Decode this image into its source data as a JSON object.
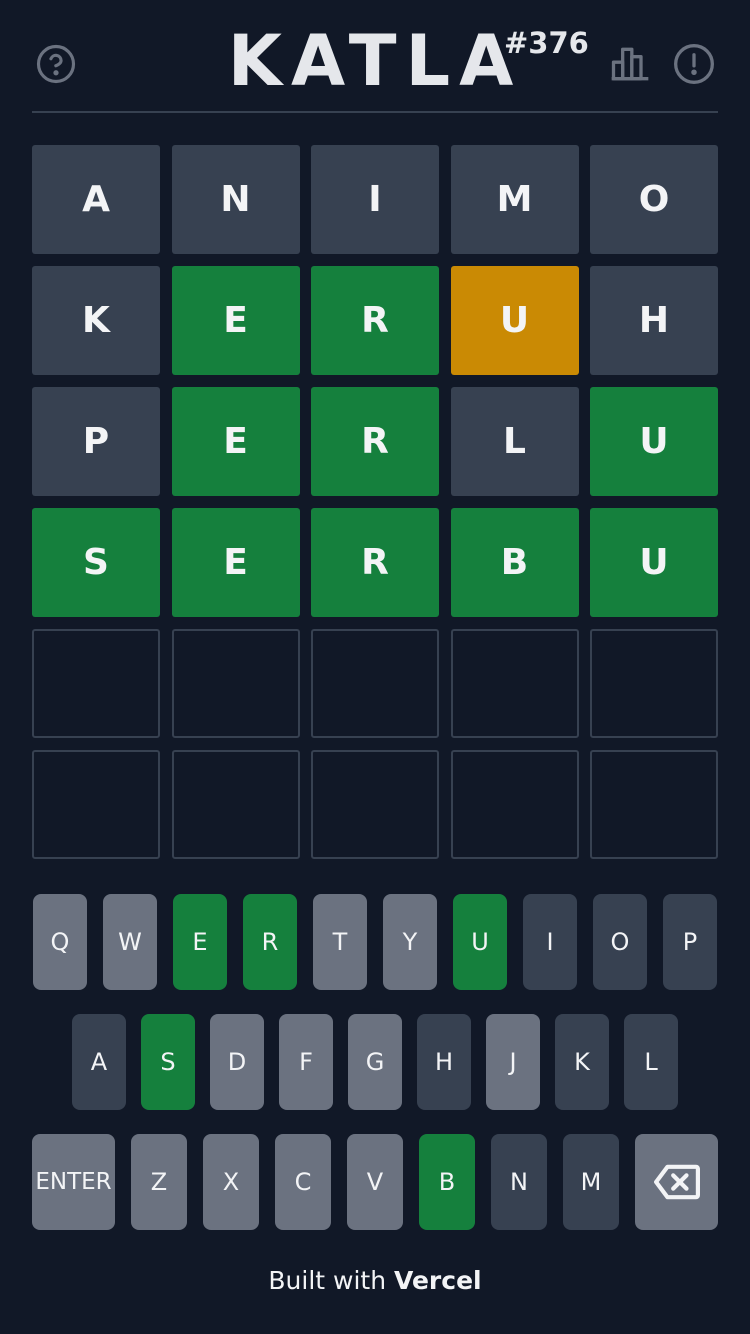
{
  "header": {
    "title": "KATLA",
    "game_number": "#376",
    "icons": [
      "help-icon",
      "stats-icon",
      "about-icon"
    ]
  },
  "board": {
    "rows": [
      [
        {
          "letter": "A",
          "state": "absent"
        },
        {
          "letter": "N",
          "state": "absent"
        },
        {
          "letter": "I",
          "state": "absent"
        },
        {
          "letter": "M",
          "state": "absent"
        },
        {
          "letter": "O",
          "state": "absent"
        }
      ],
      [
        {
          "letter": "K",
          "state": "absent"
        },
        {
          "letter": "E",
          "state": "correct"
        },
        {
          "letter": "R",
          "state": "correct"
        },
        {
          "letter": "U",
          "state": "present"
        },
        {
          "letter": "H",
          "state": "absent"
        }
      ],
      [
        {
          "letter": "P",
          "state": "absent"
        },
        {
          "letter": "E",
          "state": "correct"
        },
        {
          "letter": "R",
          "state": "correct"
        },
        {
          "letter": "L",
          "state": "absent"
        },
        {
          "letter": "U",
          "state": "correct"
        }
      ],
      [
        {
          "letter": "S",
          "state": "correct"
        },
        {
          "letter": "E",
          "state": "correct"
        },
        {
          "letter": "R",
          "state": "correct"
        },
        {
          "letter": "B",
          "state": "correct"
        },
        {
          "letter": "U",
          "state": "correct"
        }
      ],
      [
        {
          "letter": "",
          "state": "empty"
        },
        {
          "letter": "",
          "state": "empty"
        },
        {
          "letter": "",
          "state": "empty"
        },
        {
          "letter": "",
          "state": "empty"
        },
        {
          "letter": "",
          "state": "empty"
        }
      ],
      [
        {
          "letter": "",
          "state": "empty"
        },
        {
          "letter": "",
          "state": "empty"
        },
        {
          "letter": "",
          "state": "empty"
        },
        {
          "letter": "",
          "state": "empty"
        },
        {
          "letter": "",
          "state": "empty"
        }
      ]
    ]
  },
  "keyboard": {
    "rows": [
      [
        {
          "key": "Q",
          "state": "unused"
        },
        {
          "key": "W",
          "state": "unused"
        },
        {
          "key": "E",
          "state": "correct"
        },
        {
          "key": "R",
          "state": "correct"
        },
        {
          "key": "T",
          "state": "unused"
        },
        {
          "key": "Y",
          "state": "unused"
        },
        {
          "key": "U",
          "state": "correct"
        },
        {
          "key": "I",
          "state": "absent"
        },
        {
          "key": "O",
          "state": "absent"
        },
        {
          "key": "P",
          "state": "absent"
        }
      ],
      [
        {
          "key": "A",
          "state": "absent"
        },
        {
          "key": "S",
          "state": "correct"
        },
        {
          "key": "D",
          "state": "unused"
        },
        {
          "key": "F",
          "state": "unused"
        },
        {
          "key": "G",
          "state": "unused"
        },
        {
          "key": "H",
          "state": "absent"
        },
        {
          "key": "J",
          "state": "unused"
        },
        {
          "key": "K",
          "state": "absent"
        },
        {
          "key": "L",
          "state": "absent"
        }
      ],
      [
        {
          "key": "ENTER",
          "state": "unused"
        },
        {
          "key": "Z",
          "state": "unused"
        },
        {
          "key": "X",
          "state": "unused"
        },
        {
          "key": "C",
          "state": "unused"
        },
        {
          "key": "V",
          "state": "unused"
        },
        {
          "key": "B",
          "state": "correct"
        },
        {
          "key": "N",
          "state": "absent"
        },
        {
          "key": "M",
          "state": "absent"
        },
        {
          "key": "",
          "state": "unused",
          "icon": "backspace-icon"
        }
      ]
    ]
  },
  "footer": {
    "prefix": "Built with ",
    "brand": "Vercel"
  },
  "colors": {
    "background": "#111827",
    "correct": "#15803d",
    "present": "#ca8a04",
    "absent": "#374151",
    "unused": "#6b7280"
  }
}
